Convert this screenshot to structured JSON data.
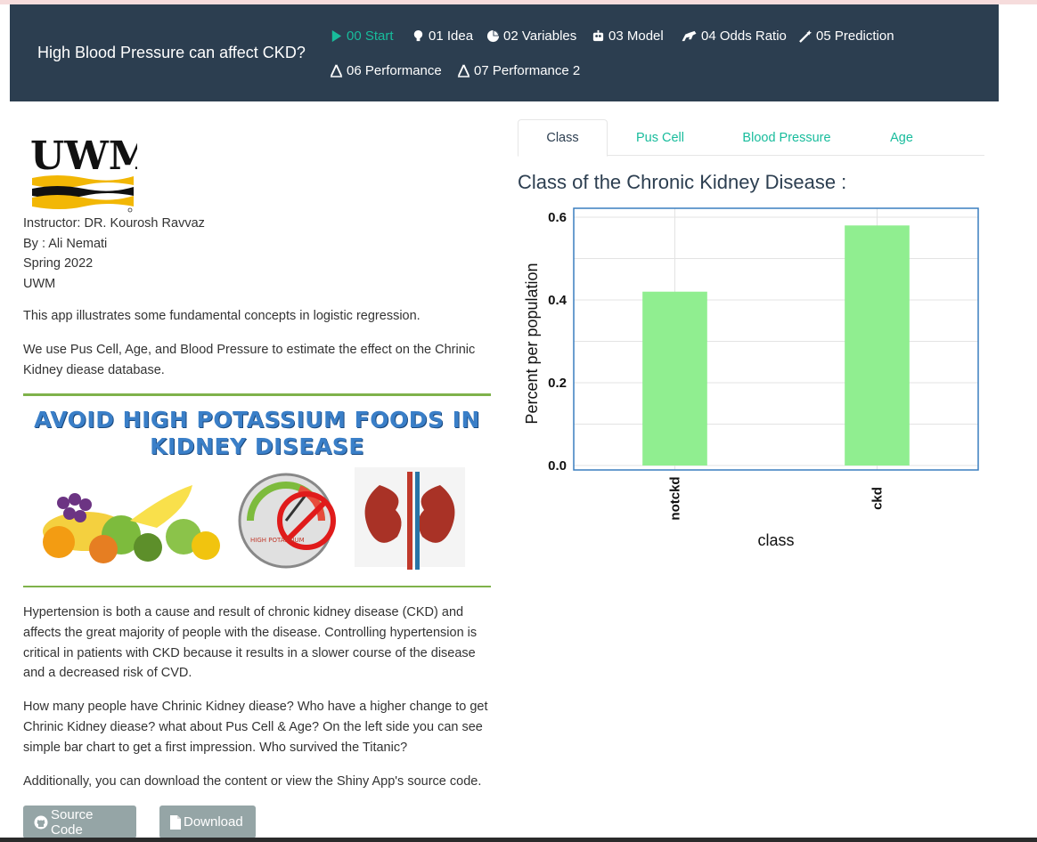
{
  "navbar": {
    "title": "High Blood Pressure can affect CKD?",
    "items": [
      {
        "label": "00 Start",
        "icon": "play-icon",
        "active": true
      },
      {
        "label": "01 Idea",
        "icon": "lightbulb-icon"
      },
      {
        "label": "02 Variables",
        "icon": "pie-chart-icon"
      },
      {
        "label": "03 Model",
        "icon": "robot-icon"
      },
      {
        "label": "04 Odds Ratio",
        "icon": "horse-icon"
      },
      {
        "label": "05 Prediction",
        "icon": "magic-wand-icon"
      },
      {
        "label": "06 Performance",
        "icon": "drafting-compass-icon"
      },
      {
        "label": "07 Performance 2",
        "icon": "drafting-compass-icon"
      }
    ]
  },
  "sidebar": {
    "logo_text": "UWM",
    "instructor": "Instructor: DR. Kourosh Ravvaz",
    "author": "By : Ali Nemati",
    "term": "Spring 2022",
    "school": "UWM",
    "intro": "This app illustrates some fundamental concepts in logistic regression.",
    "usage": "We use Pus Cell, Age, and Blood Pressure to estimate the effect on the Chrinic Kidney diease database.",
    "banner_title": "AVOID HIGH POTASSIUM FOODS IN KIDNEY DISEASE",
    "banner_gauge_label": "HIGH POTASSIUM",
    "hypertension": "Hypertension is both a cause and result of chronic kidney disease (CKD) and affects the great majority of people with the disease. Controlling hypertension is critical in patients with CKD because it results in a slower course of the disease and a decreased risk of CVD.",
    "questions": "How many people have Chrinic Kidney diease? Who have a higher change to get Chrinic Kidney diease? what about Pus Cell & Age? On the left side you can see simple bar chart to get a first impression. Who survived the Titanic?",
    "additionally": "Additionally, you can download the content or view the Shiny App's source code.",
    "source_button": "Source Code",
    "download_button": "Download"
  },
  "tabs": [
    {
      "label": "Class",
      "active": true
    },
    {
      "label": "Pus Cell"
    },
    {
      "label": "Blood Pressure"
    },
    {
      "label": "Age"
    }
  ],
  "chart_heading": "Class of the Chronic Kidney Disease :",
  "chart_data": {
    "type": "bar",
    "categories": [
      "notckd",
      "ckd"
    ],
    "values": [
      0.42,
      0.58
    ],
    "xlabel": "class",
    "ylabel": "Percent per population",
    "ylim": [
      0,
      0.6
    ],
    "yticks": [
      "0.0",
      "0.2",
      "0.4",
      "0.6"
    ],
    "bar_color": "#90ee90",
    "frame_color": "#3a7ebf",
    "grid": true
  },
  "colors": {
    "navbar": "#2c3e50",
    "accent": "#18bc9c",
    "button": "#95a5a6"
  }
}
